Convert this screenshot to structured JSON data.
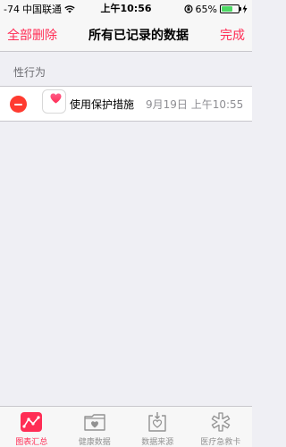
{
  "status_bar": {
    "signal": "-74",
    "carrier": "中国联通",
    "time": "上午10:56",
    "battery_percent": "65%",
    "battery_level": 0.65
  },
  "nav": {
    "left_label": "全部删除",
    "title": "所有已记录的数据",
    "right_label": "完成"
  },
  "section": {
    "header": "性行为"
  },
  "records": [
    {
      "title": "使用保护措施",
      "detail": "9月19日 上午10:55",
      "icon": "health-heart-icon"
    }
  ],
  "tabs": [
    {
      "label": "图表汇总",
      "icon": "chart-icon",
      "active": true
    },
    {
      "label": "健康数据",
      "icon": "folder-heart-icon",
      "active": false
    },
    {
      "label": "数据来源",
      "icon": "download-heart-icon",
      "active": false
    },
    {
      "label": "医疗急救卡",
      "icon": "medical-star-icon",
      "active": false
    }
  ],
  "colors": {
    "accent": "#ff2d55",
    "delete": "#ff3b30",
    "background": "#efeff4"
  }
}
